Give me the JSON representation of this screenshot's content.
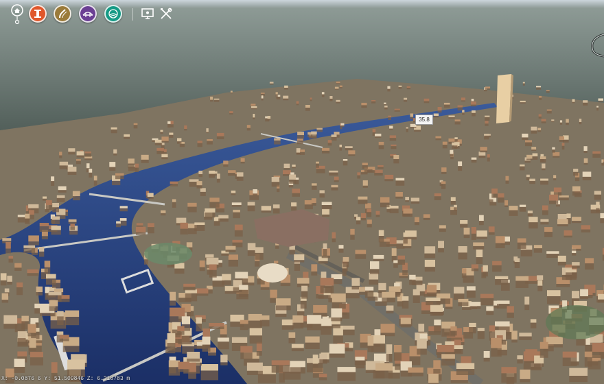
{
  "toolbar": {
    "tools": [
      {
        "name": "home",
        "icon": "home-icon"
      },
      {
        "name": "building",
        "icon": "building-icon",
        "color": "#e0572b"
      },
      {
        "name": "road",
        "icon": "road-icon",
        "color": "#9b7b3a"
      },
      {
        "name": "bridge",
        "icon": "bridge-icon",
        "color": "#6b3f94"
      },
      {
        "name": "terrain",
        "icon": "terrain-icon",
        "color": "#159a85"
      },
      {
        "name": "presentation",
        "icon": "monitor-icon"
      },
      {
        "name": "tools",
        "icon": "wrench-screwdriver-icon"
      }
    ]
  },
  "map": {
    "height_label": "35.8",
    "water_color": "#1d3570",
    "ground_color": "#3f5a48",
    "building_color": "#c8ad8b"
  },
  "status": {
    "coordinates": "X: -0.0876 6 Y: 51.509846 Z: 6.318783 m"
  }
}
